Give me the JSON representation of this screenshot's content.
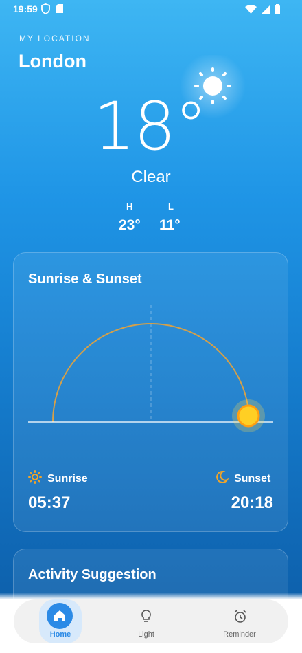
{
  "status_bar": {
    "time": "19:59"
  },
  "header": {
    "caption": "MY LOCATION",
    "city": "London",
    "temperature": "18°",
    "condition": "Clear",
    "high_label": "H",
    "low_label": "L",
    "high_value": "23°",
    "low_value": "11°"
  },
  "sun_card": {
    "title": "Sunrise & Sunset",
    "sunrise_label": "Sunrise",
    "sunset_label": "Sunset",
    "sunrise_time": "05:37",
    "sunset_time": "20:18"
  },
  "activity_card": {
    "title": "Activity Suggestion"
  },
  "nav": {
    "items": [
      {
        "label": "Home",
        "icon": "home-icon",
        "active": true
      },
      {
        "label": "Light",
        "icon": "lightbulb-icon",
        "active": false
      },
      {
        "label": "Reminder",
        "icon": "alarm-clock-icon",
        "active": false
      }
    ]
  },
  "colors": {
    "accent": "#2b8ae6",
    "sun": "#ffcf24",
    "arc": "#d4a04a"
  }
}
